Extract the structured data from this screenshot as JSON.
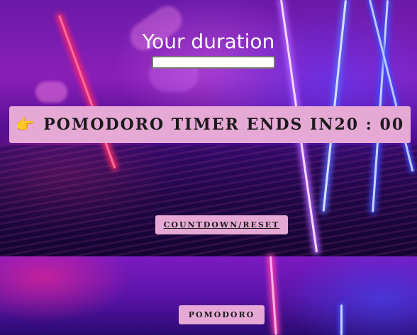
{
  "duration": {
    "label": "Your duration",
    "value": "",
    "placeholder": ""
  },
  "timer": {
    "icon": "pointing-hand-icon",
    "text": "POMODORO TIMER ENDS IN",
    "time": "20 : 00"
  },
  "buttons": {
    "countdown_reset": "COUNTDOWN/RESET",
    "pomodoro": "POMODORO"
  },
  "colors": {
    "panel": "#e6a9d6",
    "icon": "#f2c230"
  }
}
